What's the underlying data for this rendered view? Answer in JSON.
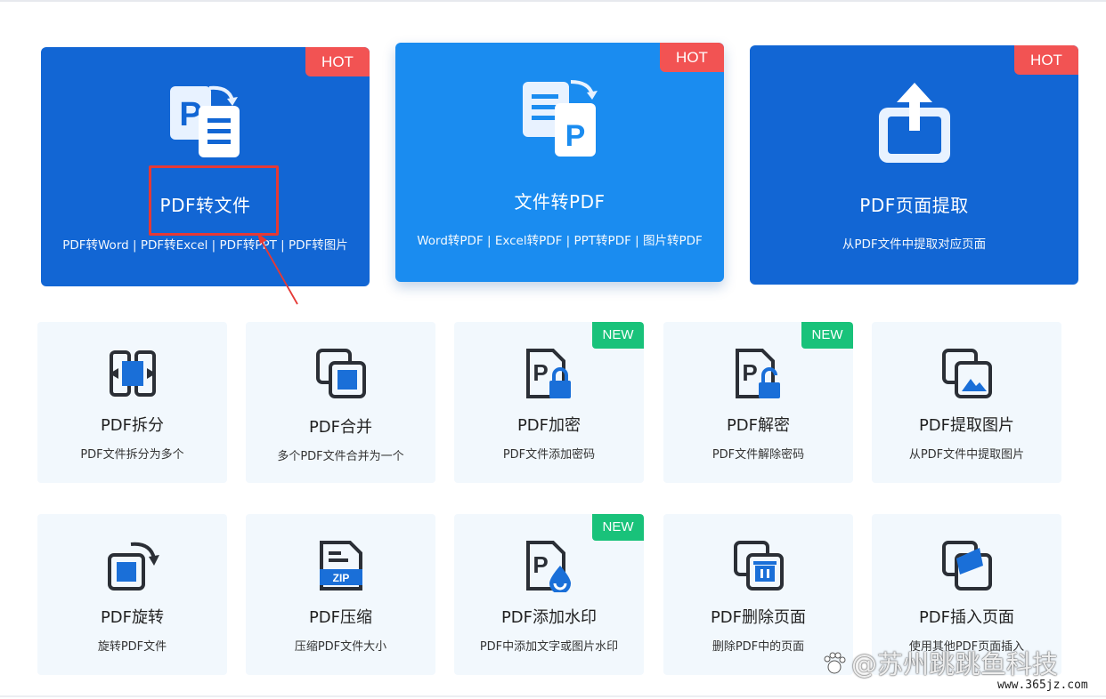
{
  "colors": {
    "primary": "#1266d4",
    "primary_light": "#1a8cf0",
    "hot": "#f25353",
    "new": "#19c27a",
    "card_bg": "#f2f8fd",
    "icon_dark": "#2b2f36",
    "icon_blue": "#1a6fd8"
  },
  "featured": [
    {
      "icon": "pdf-to-word-icon",
      "badge": "HOT",
      "title": "PDF转文件",
      "subtitle": "PDF转Word |  PDF转Excel  |  PDF转PPT  |  PDF转图片"
    },
    {
      "icon": "file-to-pdf-icon",
      "badge": "HOT",
      "title": "文件转PDF",
      "subtitle": "Word转PDF |  Excel转PDF  |  PPT转PDF  |  图片转PDF"
    },
    {
      "icon": "extract-page-icon",
      "badge": "HOT",
      "title": "PDF页面提取",
      "subtitle": "从PDF文件中提取对应页面"
    }
  ],
  "tools": [
    {
      "icon": "split-icon",
      "title": "PDF拆分",
      "subtitle": "PDF文件拆分为多个",
      "badge": ""
    },
    {
      "icon": "merge-icon",
      "title": "PDF合并",
      "subtitle": "多个PDF文件合并为一个",
      "badge": ""
    },
    {
      "icon": "encrypt-icon",
      "title": "PDF加密",
      "subtitle": "PDF文件添加密码",
      "badge": "NEW"
    },
    {
      "icon": "decrypt-icon",
      "title": "PDF解密",
      "subtitle": "PDF文件解除密码",
      "badge": "NEW"
    },
    {
      "icon": "extract-image-icon",
      "title": "PDF提取图片",
      "subtitle": "从PDF文件中提取图片",
      "badge": ""
    },
    {
      "icon": "rotate-icon",
      "title": "PDF旋转",
      "subtitle": "旋转PDF文件",
      "badge": ""
    },
    {
      "icon": "compress-zip-icon",
      "title": "PDF压缩",
      "subtitle": "压缩PDF文件大小",
      "badge": "",
      "zip_label": "ZIP"
    },
    {
      "icon": "watermark-icon",
      "title": "PDF添加水印",
      "subtitle": "PDF中添加文字或图片水印",
      "badge": "NEW"
    },
    {
      "icon": "delete-page-icon",
      "title": "PDF删除页面",
      "subtitle": "删除PDF中的页面",
      "badge": ""
    },
    {
      "icon": "insert-page-icon",
      "title": "PDF插入页面",
      "subtitle": "使用其他PDF页面插入",
      "badge": ""
    }
  ],
  "watermark": {
    "text": "@苏州跳跳鱼科技",
    "site": "www.365jz.com"
  }
}
